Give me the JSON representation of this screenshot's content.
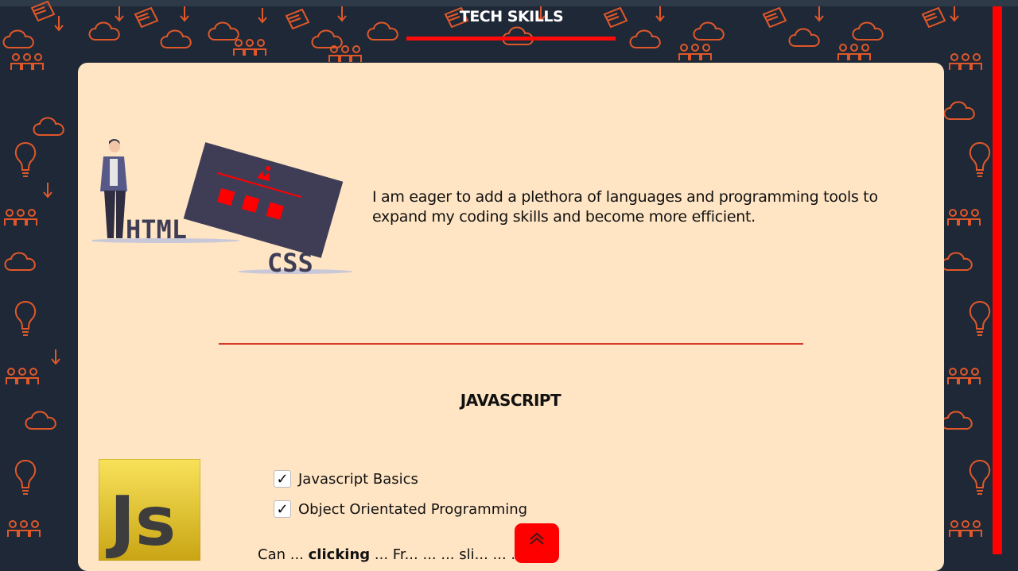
{
  "section": {
    "title": "TECH SKILLS"
  },
  "intro": {
    "text": "I am eager to add a plethora of languages and programming tools to expand my coding skills and become more efficient."
  },
  "illustration": {
    "html_word": "HTML",
    "css_word": "CSS"
  },
  "javascript": {
    "title": "JAVASCRIPT",
    "logo_text": "Js",
    "skills": [
      {
        "label": "Javascript Basics",
        "checked": true,
        "mark": "✓"
      },
      {
        "label": "Object Orientated Programming",
        "checked": true,
        "mark": "✓"
      }
    ],
    "cutoff_text_start": "Can ...",
    "cutoff_bold": "clicking",
    "cutoff_text_end": "... Fr...  ...  ... sli...    ...   ...   fil"
  },
  "colors": {
    "accent": "#ff0000",
    "card": "#ffe5c4",
    "background": "#1f2836",
    "doodle": "#e0582a"
  },
  "icons": {
    "back_to_top": "chevron-double-up-icon",
    "check": "checkmark-icon"
  }
}
